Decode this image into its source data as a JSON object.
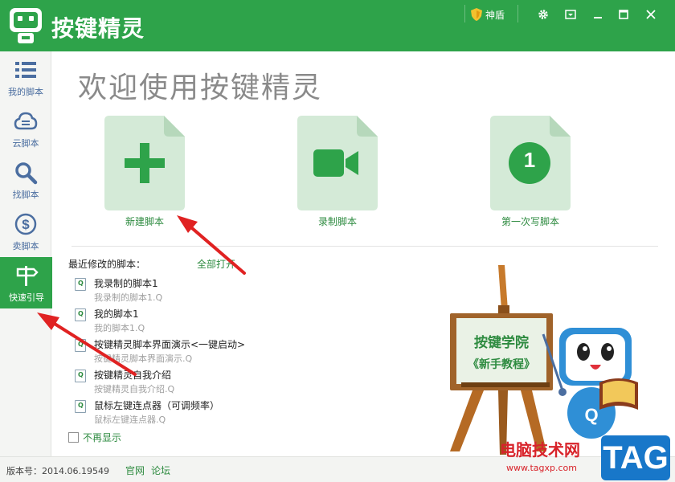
{
  "app": {
    "title": "按键精灵",
    "shield_label": "神盾"
  },
  "sidebar": {
    "items": [
      {
        "label": "我的脚本",
        "icon": "list-icon"
      },
      {
        "label": "云脚本",
        "icon": "cloud-icon"
      },
      {
        "label": "找脚本",
        "icon": "search-icon"
      },
      {
        "label": "卖脚本",
        "icon": "dollar-icon"
      },
      {
        "label": "快速引导",
        "icon": "signpost-icon",
        "active": true
      }
    ]
  },
  "main": {
    "welcome": "欢迎使用按键精灵",
    "cards": [
      {
        "label": "新建脚本",
        "icon": "plus-icon"
      },
      {
        "label": "录制脚本",
        "icon": "video-camera-icon"
      },
      {
        "label": "第一次写脚本",
        "icon": "number-one-icon",
        "number": "1"
      }
    ],
    "recent_title": "最近修改的脚本：",
    "open_all": "全部打开",
    "recent": [
      {
        "name": "我录制的脚本1",
        "file": "我录制的脚本1.Q"
      },
      {
        "name": "我的脚本1",
        "file": "我的脚本1.Q"
      },
      {
        "name": "按键精灵脚本界面演示<一键启动>",
        "file": "按键精灵脚本界面演示.Q"
      },
      {
        "name": "按键精灵自我介绍",
        "file": "按键精灵自我介绍.Q"
      },
      {
        "name": "鼠标左键连点器（可调频率）",
        "file": "鼠标左键连点器.Q"
      }
    ],
    "no_show": "不再显示"
  },
  "academy": {
    "line1": "按键学院",
    "line2": "《新手教程》"
  },
  "status": {
    "version": "版本号：2014.06.19549",
    "links": [
      "官网",
      "论坛"
    ]
  },
  "watermark": {
    "text": "电脑技术网",
    "url": "www.tagxp.com",
    "tag": "TAG"
  },
  "colors": {
    "brand_green": "#2ea34a",
    "card_bg": "#d4ead7",
    "arrow_red": "#e02222"
  }
}
